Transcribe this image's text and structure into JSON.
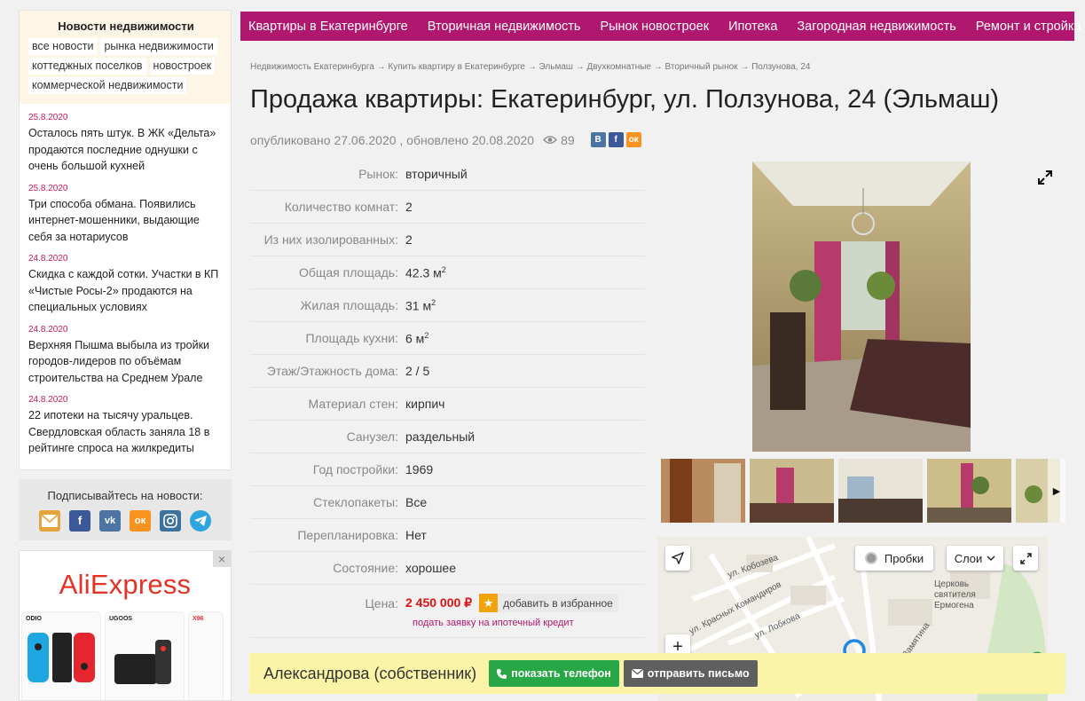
{
  "left": {
    "news_title": "Новости недвижимости",
    "tags": [
      "все новости",
      "рынка недвижимости",
      "коттеджных поселков",
      "новостроек",
      "коммерческой недвижимости"
    ],
    "news": [
      {
        "date": "25.8.2020",
        "title": "Осталось пять штук. В ЖК «Дельта» продаются последние однушки с очень большой кухней"
      },
      {
        "date": "25.8.2020",
        "title": "Три способа обмана. Появились интернет-мошенники, выдающие себя за нотариусов"
      },
      {
        "date": "24.8.2020",
        "title": "Скидка с каждой сотки. Участки в КП «Чистые Росы-2» продаются на специальных условиях"
      },
      {
        "date": "24.8.2020",
        "title": "Верхняя Пышма выбыла из тройки городов-лидеров по объёмам строительства на Среднем Урале"
      },
      {
        "date": "24.8.2020",
        "title": "22 ипотеки на тысячу уральцев. Свердловская область заняла 18 в рейтинге спроса на жилкредиты"
      }
    ],
    "subscribe_label": "Подписывайтесь на новости:",
    "ad": {
      "logo": "AliExpress",
      "products": [
        "ODIO",
        "UGOOS",
        "X96"
      ]
    }
  },
  "nav": [
    "Квартиры в Екатеринбурге",
    "Вторичная недвижимость",
    "Рынок новостроек",
    "Ипотека",
    "Загородная недвижимость",
    "Ремонт и стройка"
  ],
  "breadcrumbs": "Недвижимость Екатеринбурга → Купить квартиру в Екатеринбурге → Эльмаш → Двухкомнатные → Вторичный рынок → Ползунова, 24",
  "title": "Продажа квартиры: Екатеринбург, ул. Ползунова, 24 (Эльмаш)",
  "meta": {
    "published": "опубликовано 27.06.2020 , обновлено 20.08.2020",
    "views": "89",
    "share": {
      "vk": "В",
      "fb": "f",
      "ok": "ок"
    }
  },
  "props": [
    {
      "label": "Рынок:",
      "value": "вторичный"
    },
    {
      "label": "Количество комнат:",
      "value": "2"
    },
    {
      "label": "Из них изолированных:",
      "value": "2"
    },
    {
      "label": "Общая площадь:",
      "value": "42.3 м",
      "sup": "2"
    },
    {
      "label": "Жилая площадь:",
      "value": "31 м",
      "sup": "2"
    },
    {
      "label": "Площадь кухни:",
      "value": "6 м",
      "sup": "2"
    },
    {
      "label": "Этаж/Этажность дома:",
      "value": "2 / 5"
    },
    {
      "label": "Материал стен:",
      "value": "кирпич"
    },
    {
      "label": "Санузел:",
      "value": "раздельный"
    },
    {
      "label": "Год постройки:",
      "value": "1969"
    },
    {
      "label": "Стеклопакеты:",
      "value": "Все"
    },
    {
      "label": "Перепланировка:",
      "value": "Нет"
    },
    {
      "label": "Состояние:",
      "value": "хорошее"
    }
  ],
  "price": {
    "label": "Цена:",
    "value": "2 450 000 ₽",
    "fav_label": "добавить в избранное",
    "mortgage_link": "подать заявку на ипотечный кредит"
  },
  "map": {
    "traffic_label": "Пробки",
    "layers_label": "Слои",
    "zoom_in": "+",
    "streets": [
      "ул. Кобозева",
      "ул. Красных Командиров",
      "ул. Лобкова",
      "пер. Замятина"
    ],
    "poi": [
      "Церковь",
      "святителя",
      "Ермогена"
    ]
  },
  "contact": {
    "name": "Александрова (собственник)",
    "phone_btn": "показать телефон",
    "mail_btn": "отправить письмо"
  },
  "colors": {
    "accent": "#b0176e",
    "price": "#dd1111",
    "phone": "#27a745",
    "mail": "#5f5f5f",
    "contact_bg": "#fbf3a5"
  }
}
